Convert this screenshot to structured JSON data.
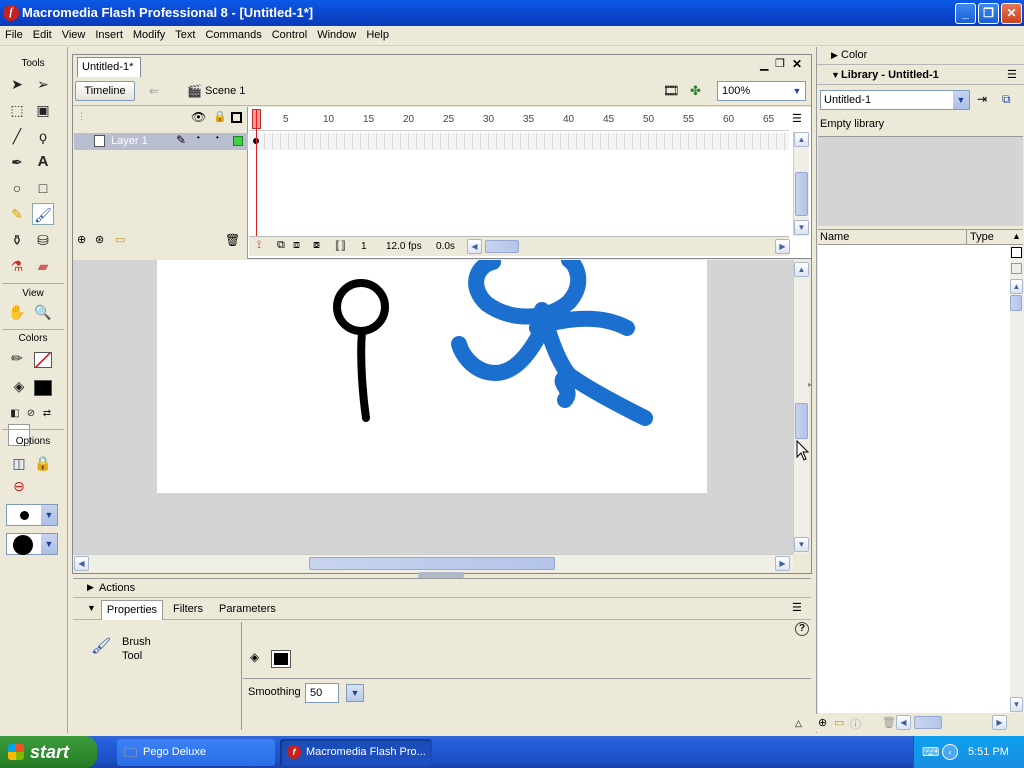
{
  "window": {
    "title": "Macromedia Flash Professional 8 - [Untitled-1*]",
    "icon": "flash-app-icon"
  },
  "menubar": [
    "File",
    "Edit",
    "View",
    "Insert",
    "Modify",
    "Text",
    "Commands",
    "Control",
    "Window",
    "Help"
  ],
  "tools": {
    "heading": "Tools",
    "view_heading": "View",
    "colors_heading": "Colors",
    "options_heading": "Options",
    "selected_tool": "brush-tool"
  },
  "document": {
    "tab_label": "Untitled-1*",
    "timeline_button": "Timeline",
    "scene_label": "Scene 1",
    "zoom": "100%",
    "layer_name": "Layer 1",
    "frame_numbers": [
      "1",
      "5",
      "10",
      "15",
      "20",
      "25",
      "30",
      "35",
      "40",
      "45",
      "50",
      "55",
      "60",
      "65"
    ],
    "current_frame": "1",
    "frame_rate": "12.0 fps",
    "elapsed_time": "0.0s"
  },
  "panels": {
    "actions_label": "Actions",
    "properties_tabs": [
      "Properties",
      "Filters",
      "Parameters"
    ],
    "tool_name_line1": "Brush",
    "tool_name_line2": "Tool",
    "smoothing_label": "Smoothing",
    "smoothing_value": "50"
  },
  "right_panel": {
    "color_label": "Color",
    "library_title": "Library - Untitled-1",
    "library_document": "Untitled-1",
    "library_status": "Empty library",
    "col_name": "Name",
    "col_type": "Type"
  },
  "taskbar": {
    "start_label": "start",
    "tasks": [
      "Pego Deluxe",
      "Macromedia Flash Pro..."
    ],
    "clock": "5:51 PM"
  },
  "colors": {
    "stroke_black": "#000000",
    "brush_blue": "#1a6fcf",
    "xp_blue": "#0b47d0"
  }
}
